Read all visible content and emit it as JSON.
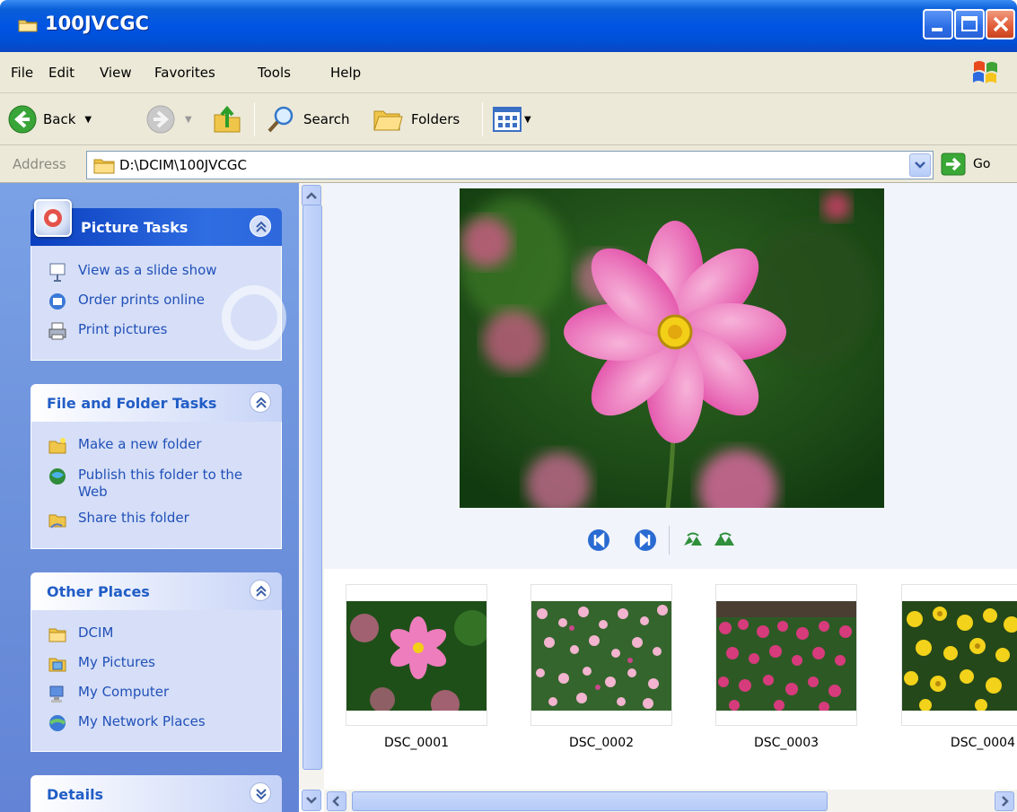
{
  "window": {
    "title": "100JVCGC",
    "icon": "folder-icon",
    "controls": [
      "minimize-icon",
      "maximize-icon",
      "close-icon"
    ]
  },
  "menu": {
    "items": [
      {
        "label": "File",
        "mnemonic": "F"
      },
      {
        "label": "Edit",
        "mnemonic": "E"
      },
      {
        "label": "View",
        "mnemonic": "V"
      },
      {
        "label": "Favorites",
        "mnemonic": "a"
      },
      {
        "label": "Tools",
        "mnemonic": "T"
      },
      {
        "label": "Help",
        "mnemonic": "H"
      }
    ]
  },
  "toolbar": {
    "back": "Back",
    "search": "Search",
    "folders": "Folders"
  },
  "address": {
    "label": "Address",
    "path": "D:\\DCIM\\100JVCGC",
    "go": "Go"
  },
  "panes": {
    "picture_tasks": {
      "title": "Picture Tasks",
      "items": [
        "View as a slide show",
        "Order prints online",
        "Print pictures"
      ]
    },
    "file_folder_tasks": {
      "title": "File and Folder Tasks",
      "items": [
        "Make a new folder",
        "Publish this folder to the Web",
        "Share this folder"
      ]
    },
    "other_places": {
      "title": "Other Places",
      "items": [
        "DCIM",
        "My Pictures",
        "My Computer",
        "My Network Places"
      ]
    },
    "details": {
      "title": "Details"
    }
  },
  "thumbnails": [
    {
      "name": "DSC_0001"
    },
    {
      "name": "DSC_0002"
    },
    {
      "name": "DSC_0003"
    },
    {
      "name": "DSC_0004"
    }
  ],
  "colors": {
    "title_bar": "#0054e3",
    "task_pane": "#6b8fda",
    "link_text": "#215dc6",
    "chrome": "#ece9d8"
  }
}
